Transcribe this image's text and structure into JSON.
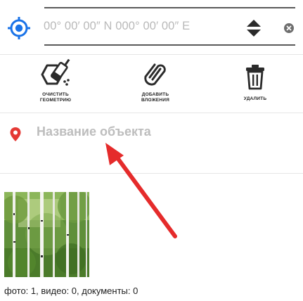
{
  "coordinate_bar": {
    "value": "00° 00′ 00″ N 000° 00′ 00″ E",
    "icons": {
      "locate": "crosshair-target-icon",
      "toggle": "up-down-arrows-icon",
      "clear": "clear-circle-x-icon"
    }
  },
  "actions": {
    "clear_geometry": {
      "label": "ОЧИСТИТЬ\nГЕОМЕТРИЮ",
      "icon": "eraser-shape-icon"
    },
    "add_attachments": {
      "label": "ДОБАВИТЬ\nВЛОЖЕНИЯ",
      "icon": "paperclip-icon"
    },
    "delete": {
      "label": "УДАЛИТЬ",
      "icon": "trash-icon"
    }
  },
  "object_name": {
    "placeholder": "Название объекта",
    "icon": "location-pin-icon"
  },
  "attachments": {
    "thumbnail": "birch-forest-photo",
    "summary": "фото: 1, видео: 0, документы: 0"
  },
  "colors": {
    "accent_blue": "#1a73e8",
    "pin_red": "#e53935",
    "arrow_red": "#e52b2b",
    "placeholder_gray": "#bdbdbd"
  }
}
